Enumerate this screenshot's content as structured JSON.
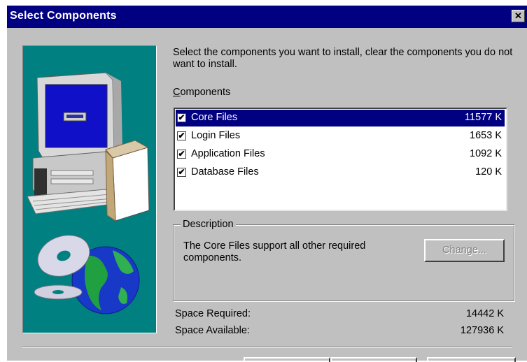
{
  "window": {
    "title": "Select Components",
    "close_glyph": "✕"
  },
  "instructions": "Select the components you want to install, clear the components you do not want to install.",
  "components_label": {
    "underlined_char": "C",
    "rest": "omponents"
  },
  "components": [
    {
      "name": "Core Files",
      "size": "11577 K",
      "checked": true,
      "selected": true
    },
    {
      "name": "Login Files",
      "size": "1653 K",
      "checked": true,
      "selected": false
    },
    {
      "name": "Application Files",
      "size": "1092 K",
      "checked": true,
      "selected": false
    },
    {
      "name": "Database Files",
      "size": "120 K",
      "checked": true,
      "selected": false
    }
  ],
  "check_glyph": "✔",
  "description": {
    "legend": "Description",
    "text": "The Core Files support all other required components.",
    "change_button": "Change..."
  },
  "space": {
    "required_label": "Space Required:",
    "required_value": "14442 K",
    "available_label": "Space Available:",
    "available_value": "127936 K"
  },
  "colors": {
    "title_bar": "#000080",
    "dialog_face": "#c0c0c0",
    "art_panel": "#008080",
    "selection": "#000080"
  },
  "icons": [
    "close-icon",
    "computer-icon",
    "cd-icon",
    "globe-icon",
    "checkbox-icon"
  ]
}
